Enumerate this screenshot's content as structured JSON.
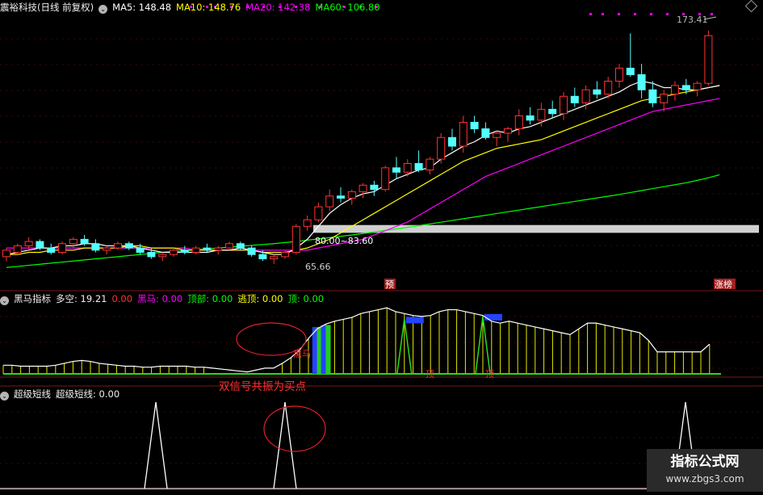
{
  "main_panel": {
    "stock_name": "震裕科技(日线 前复权)",
    "ma5": "MA5: 148.48",
    "ma10": "MA10: 148.76",
    "ma20": "MA20: 142.38",
    "ma60": "MA60: 106.80",
    "high_label": "173.41",
    "low_label": "65.66",
    "range_label": "80.00~83.60",
    "badge_yu": "预",
    "badge_zhangbang": "涨榜",
    "colors": {
      "ma5": "#ffffff",
      "ma10": "#ffff00",
      "ma20": "#ff00ff",
      "ma60": "#00ff00",
      "up": "#ff3232",
      "down": "#54ffff"
    }
  },
  "heima_panel": {
    "name": "黑马指标",
    "duokong": "多空: 19.21",
    "v1": "0.00",
    "heima": "黑马: 0.00",
    "dingbu": "顶部: 0.00",
    "taoding": "逃顶: 0.00",
    "ding": "顶: 0.00",
    "heima_mark": "黑马",
    "ding_mark": "顶",
    "annotation": "双信号共振为买点"
  },
  "chaoji_panel": {
    "name": "超级短线",
    "value": "超级短线: 0.00"
  },
  "watermark": {
    "title": "指标公式网",
    "url": "www.zbgs3.com"
  },
  "chart_data": {
    "type": "candlestick",
    "candles": [
      [
        69,
        73,
        67,
        72
      ],
      [
        71,
        75,
        70,
        74
      ],
      [
        74,
        78,
        72,
        76
      ],
      [
        76,
        77,
        72,
        73
      ],
      [
        73,
        75,
        70,
        71
      ],
      [
        71,
        76,
        70,
        75
      ],
      [
        75,
        78,
        73,
        77
      ],
      [
        77,
        79,
        74,
        75
      ],
      [
        75,
        77,
        71,
        72
      ],
      [
        72,
        74,
        70,
        73
      ],
      [
        73,
        76,
        72,
        75
      ],
      [
        75,
        76,
        72,
        73
      ],
      [
        73,
        75,
        70,
        71
      ],
      [
        71,
        73,
        68,
        69
      ],
      [
        69,
        71,
        67,
        70
      ],
      [
        70,
        73,
        69,
        72
      ],
      [
        72,
        74,
        70,
        71
      ],
      [
        71,
        74,
        70,
        73
      ],
      [
        73,
        75,
        71,
        72
      ],
      [
        72,
        74,
        70,
        73
      ],
      [
        73,
        76,
        72,
        75
      ],
      [
        75,
        76,
        72,
        73
      ],
      [
        73,
        74,
        69,
        70
      ],
      [
        70,
        72,
        67,
        68
      ],
      [
        68,
        70,
        65.66,
        69
      ],
      [
        69,
        72,
        68,
        71
      ],
      [
        71,
        84,
        70,
        83
      ],
      [
        83,
        88,
        81,
        86
      ],
      [
        86,
        94,
        85,
        92
      ],
      [
        92,
        100,
        90,
        97
      ],
      [
        97,
        101,
        94,
        96
      ],
      [
        96,
        100,
        93,
        99
      ],
      [
        99,
        103,
        96,
        102
      ],
      [
        102,
        104,
        97,
        100
      ],
      [
        100,
        111,
        99,
        110
      ],
      [
        110,
        115,
        105,
        108
      ],
      [
        108,
        114,
        106,
        112
      ],
      [
        112,
        118,
        108,
        109
      ],
      [
        109,
        115,
        107,
        114
      ],
      [
        114,
        126,
        112,
        124
      ],
      [
        124,
        128,
        118,
        120
      ],
      [
        120,
        134,
        117,
        131
      ],
      [
        131,
        134,
        126,
        128
      ],
      [
        128,
        131,
        123,
        124
      ],
      [
        124,
        127,
        120,
        126
      ],
      [
        126,
        129,
        122,
        128
      ],
      [
        128,
        137,
        125,
        134
      ],
      [
        134,
        138,
        130,
        132
      ],
      [
        132,
        140,
        129,
        137
      ],
      [
        137,
        141,
        133,
        135
      ],
      [
        135,
        145,
        132,
        143
      ],
      [
        143,
        147,
        138,
        140
      ],
      [
        140,
        148,
        137,
        146
      ],
      [
        146,
        150,
        142,
        144
      ],
      [
        144,
        152,
        142,
        150
      ],
      [
        150,
        158,
        147,
        156
      ],
      [
        156,
        172,
        152,
        153
      ],
      [
        153,
        158,
        142,
        146
      ],
      [
        146,
        150,
        138,
        140
      ],
      [
        140,
        146,
        136,
        144
      ],
      [
        144,
        150,
        141,
        148
      ],
      [
        148,
        151,
        144,
        146
      ],
      [
        146,
        150,
        143,
        149
      ],
      [
        149,
        173.41,
        148,
        171
      ]
    ],
    "ma5": [
      70,
      71,
      72,
      73,
      73,
      74,
      74,
      75,
      75,
      74,
      74,
      74,
      73,
      72,
      71,
      71,
      71,
      71,
      71,
      72,
      72,
      73,
      72,
      71,
      70,
      70,
      73,
      77,
      83,
      89,
      93,
      96,
      98,
      99,
      102,
      105,
      107,
      109,
      110,
      114,
      117,
      120,
      122,
      125,
      127,
      126,
      128,
      129,
      131,
      133,
      135,
      137,
      139,
      141,
      143,
      145,
      148,
      150,
      149,
      147,
      147,
      146,
      146,
      147,
      148
    ],
    "ma10": [
      70,
      70,
      71,
      71,
      72,
      72,
      72,
      73,
      73,
      73,
      73,
      74,
      74,
      73,
      73,
      73,
      72,
      72,
      72,
      72,
      72,
      72,
      72,
      71,
      71,
      71,
      72,
      73,
      75,
      77,
      80,
      83,
      86,
      89,
      92,
      95,
      98,
      101,
      104,
      107,
      110,
      113,
      115,
      117,
      119,
      120,
      121,
      122,
      123,
      125,
      127,
      129,
      131,
      133,
      135,
      137,
      139,
      141,
      142,
      143,
      144,
      145,
      146,
      147,
      148
    ],
    "ma20": [
      73,
      73,
      73,
      73,
      73,
      73,
      73,
      73,
      73,
      73,
      73,
      73,
      73,
      73,
      73,
      73,
      73,
      72,
      72,
      72,
      72,
      72,
      72,
      72,
      72,
      72,
      72,
      72,
      73,
      74,
      75,
      76,
      77,
      79,
      81,
      83,
      85,
      88,
      91,
      94,
      97,
      100,
      103,
      106,
      108,
      110,
      112,
      114,
      116,
      118,
      120,
      122,
      124,
      126,
      128,
      130,
      132,
      134,
      136,
      137,
      138,
      139,
      140,
      141,
      142
    ],
    "ma60": [
      64,
      64.5,
      65,
      65.5,
      66,
      66.5,
      67,
      67.5,
      68,
      68.5,
      69,
      69.5,
      70,
      70.5,
      71,
      71.4,
      71.8,
      72.2,
      72.6,
      73,
      73.4,
      73.8,
      74.2,
      74.6,
      75,
      75.5,
      76,
      76.6,
      77.2,
      77.8,
      78.4,
      79,
      79.7,
      80.4,
      81.1,
      81.8,
      82.5,
      83.3,
      84.1,
      84.9,
      85.7,
      86.5,
      87.3,
      88.1,
      88.9,
      89.7,
      90.5,
      91.3,
      92.1,
      92.9,
      93.7,
      94.5,
      95.3,
      96.1,
      96.9,
      97.7,
      98.6,
      99.5,
      100.4,
      101.3,
      102.2,
      103.1,
      104.2,
      105.4,
      106.8
    ],
    "heima_curve": [
      4,
      4,
      3,
      3,
      3,
      3,
      4,
      6,
      8,
      9,
      8,
      6,
      5,
      4,
      3,
      3,
      2,
      2,
      3,
      3,
      3,
      3,
      2,
      2,
      1,
      0,
      -1,
      -2,
      -3,
      -1,
      1,
      1,
      6,
      12,
      20,
      32,
      42,
      47,
      50,
      52,
      54,
      58,
      60,
      62,
      64,
      60,
      58,
      56,
      55,
      56,
      60,
      62,
      62,
      60,
      58,
      56,
      50,
      48,
      50,
      48,
      46,
      44,
      42,
      40,
      38,
      36,
      42,
      48,
      48,
      46,
      44,
      42,
      40,
      38,
      30,
      18,
      18,
      18,
      18,
      18,
      18,
      26
    ],
    "heima_bars": [
      {
        "i": 36,
        "v": 44
      },
      {
        "i": 37,
        "v": 46
      }
    ],
    "ding_signals": [
      {
        "i": 46,
        "v": 52
      },
      {
        "i": 55,
        "v": 55
      }
    ],
    "chaoji_curve": [
      0,
      0,
      0,
      0,
      0,
      0,
      0,
      0,
      0,
      0,
      0,
      0,
      1,
      0,
      0,
      0,
      0,
      0,
      0,
      0,
      0,
      0,
      0,
      1,
      0,
      0,
      0,
      0,
      0,
      0,
      0,
      0,
      0,
      0,
      0,
      0,
      0,
      0,
      0,
      0,
      0,
      0,
      0,
      0,
      0,
      0,
      0,
      0,
      0,
      0,
      0,
      0,
      0,
      0,
      0,
      0,
      0,
      0,
      0,
      0,
      0,
      0,
      1,
      0,
      0
    ],
    "ranges": {
      "price": [
        60,
        180
      ],
      "heima": [
        -5,
        65
      ]
    }
  }
}
